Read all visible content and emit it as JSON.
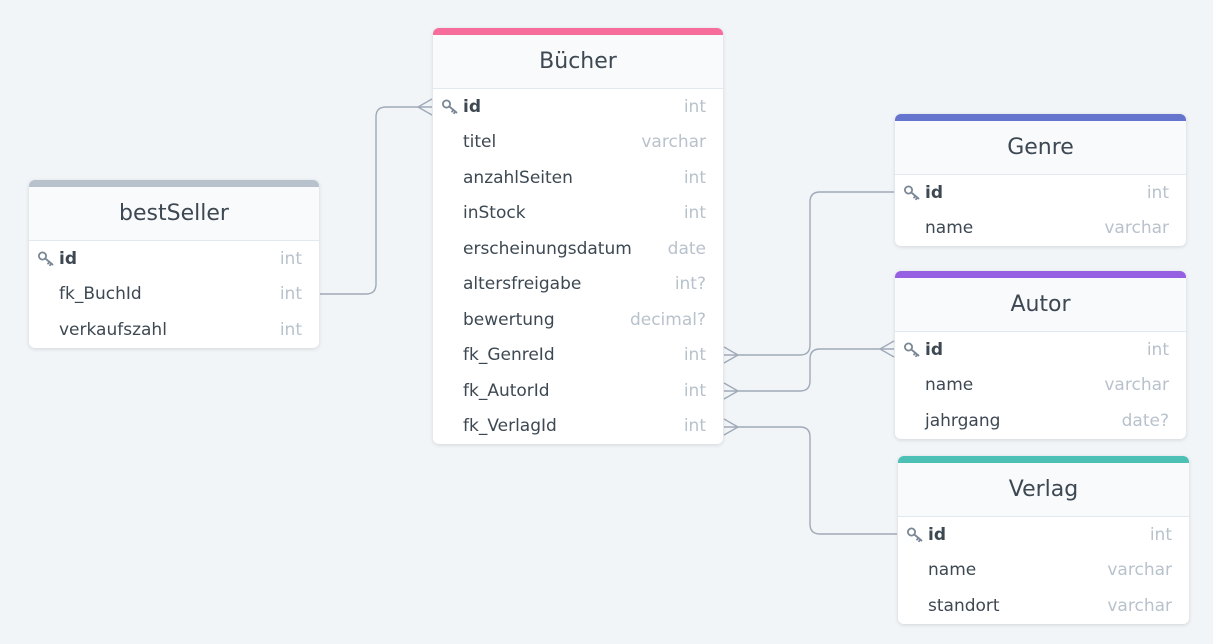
{
  "tables": {
    "bestseller": {
      "name": "bestSeller",
      "color": "#b8c2cc",
      "fields": [
        {
          "name": "id",
          "type": "int",
          "pk": true
        },
        {
          "name": "fk_BuchId",
          "type": "int"
        },
        {
          "name": "verkaufszahl",
          "type": "int"
        }
      ]
    },
    "buecher": {
      "name": "Bücher",
      "color": "#f66d9b",
      "fields": [
        {
          "name": "id",
          "type": "int",
          "pk": true
        },
        {
          "name": "titel",
          "type": "varchar"
        },
        {
          "name": "anzahlSeiten",
          "type": "int"
        },
        {
          "name": "inStock",
          "type": "int"
        },
        {
          "name": "erscheinungsdatum",
          "type": "date"
        },
        {
          "name": "altersfreigabe",
          "type": "int?"
        },
        {
          "name": "bewertung",
          "type": "decimal?"
        },
        {
          "name": "fk_GenreId",
          "type": "int"
        },
        {
          "name": "fk_AutorId",
          "type": "int"
        },
        {
          "name": "fk_VerlagId",
          "type": "int"
        }
      ]
    },
    "genre": {
      "name": "Genre",
      "color": "#6574cd",
      "fields": [
        {
          "name": "id",
          "type": "int",
          "pk": true
        },
        {
          "name": "name",
          "type": "varchar"
        }
      ]
    },
    "autor": {
      "name": "Autor",
      "color": "#9561e2",
      "fields": [
        {
          "name": "id",
          "type": "int",
          "pk": true
        },
        {
          "name": "name",
          "type": "varchar"
        },
        {
          "name": "jahrgang",
          "type": "date?"
        }
      ]
    },
    "verlag": {
      "name": "Verlag",
      "color": "#4dc0b5",
      "fields": [
        {
          "name": "id",
          "type": "int",
          "pk": true
        },
        {
          "name": "name",
          "type": "varchar"
        },
        {
          "name": "standort",
          "type": "varchar"
        }
      ]
    }
  },
  "relations": [
    {
      "from": "bestseller.fk_BuchId",
      "to": "buecher.id",
      "cardinality": "many-to-one"
    },
    {
      "from": "buecher.fk_GenreId",
      "to": "genre.id",
      "cardinality": "many-to-one"
    },
    {
      "from": "buecher.fk_AutorId",
      "to": "autor.id",
      "cardinality": "many-to-many"
    },
    {
      "from": "buecher.fk_VerlagId",
      "to": "verlag.id",
      "cardinality": "many-to-one"
    }
  ]
}
